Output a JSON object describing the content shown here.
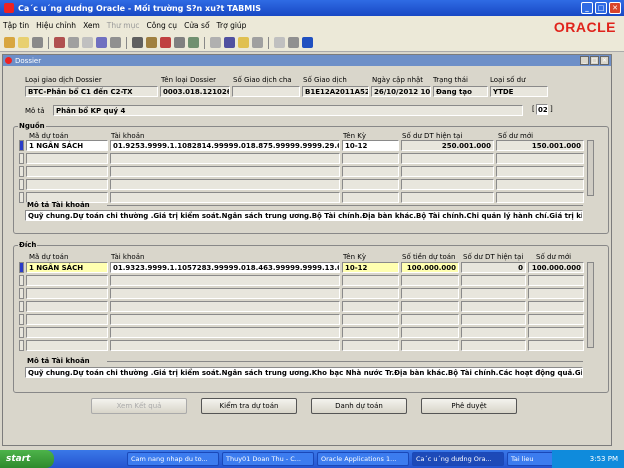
{
  "window": {
    "title": "Ca´c u´ng dưd́ng Oracle - Mối trường S?n xu?t TABMIS"
  },
  "menu": [
    "Tập tin",
    "Hiệu chỉnh",
    "Xem",
    "Thư mục",
    "Công cụ",
    "Cửa sổ",
    "Trợ giúp"
  ],
  "menu_disabled": [
    3
  ],
  "brand": "ORACLE",
  "form": {
    "title": "Dossier",
    "header": {
      "labels": {
        "type": "Loại giao dịch Dossier",
        "type_name": "Tên loại Dossier",
        "parent_no": "Số Giao dịch cha",
        "txn_no": "Số Giao dịch",
        "updated": "Ngày cập nhật",
        "status": "Trạng thái",
        "balance_type": "Loại số dư",
        "desc": "Mô tả"
      },
      "values": {
        "type": "BTC-Phân bổ C1 đến C2-TX",
        "type_name": "0003.018.121026.k",
        "parent_no": "",
        "txn_no": "B1E12A2011A52",
        "updated": "26/10/2012 10:1",
        "status": "Đang tạo",
        "balance_type": "YTDE",
        "desc": "Phân bổ KP quý 4",
        "desc_count": "02"
      }
    },
    "source": {
      "title": "Nguồn",
      "cols": {
        "a": "Mã dự toán",
        "b": "Tài khoản",
        "c": "Tên Kỳ",
        "d": "Số dư DT hiện tại",
        "e": "Số dư mới"
      },
      "rows": [
        {
          "a": "1 NGÂN SÁCH",
          "b": "01.9253.9999.1.1082814.99999.018.875.99999.9999.29.000",
          "c": "10-12",
          "d": "250.001.000",
          "e": "150.001.000"
        }
      ],
      "desc_label": "Mô tả Tài khoản",
      "desc": "Quỹ chung.Dự toán chi thường .Giá trị kiểm soát.Ngân sách trung ương.Bộ Tài chính.Địa bàn khác.Bộ Tài chính.Chi quản lý hành chí.Giá trị kiểm"
    },
    "target": {
      "title": "Đích",
      "cols": {
        "a": "Mã dự toán",
        "b": "Tài khoản",
        "c": "Tên Kỳ",
        "d": "Số tiền dự toán",
        "e": "Số dư DT hiện tại",
        "f": "Số dư mới"
      },
      "rows": [
        {
          "a": "1 NGÂN SÁCH",
          "b": "01.9323.9999.1.1057283.99999.018.463.99999.9999.13.000",
          "c": "10-12",
          "d": "100.000.000",
          "e": "0",
          "f": "100.000.000"
        }
      ],
      "desc_label": "Mô tả Tài khoản",
      "desc": "Quỹ chung.Dự toán chi thường .Giá trị kiểm soát.Ngân sách trung ương.Kho bạc Nhà nước Tr.Địa bàn khác.Bộ Tài chính.Các hoạt động quả.Giá"
    },
    "buttons": {
      "view": "Xem Kết quả",
      "check": "Kiểm tra dự toán",
      "list": "Danh dự toán",
      "approve": "Phê duyệt"
    }
  },
  "taskbar": {
    "start": "start",
    "tasks": [
      "Cam nang nhap du to...",
      "Thuy01 Doan Thu - C...",
      "Oracle Applications 1...",
      "Ca´c u´ng dưd́ng Ora...",
      "Tai lieu"
    ],
    "active": 3,
    "clock": "3:53 PM"
  }
}
